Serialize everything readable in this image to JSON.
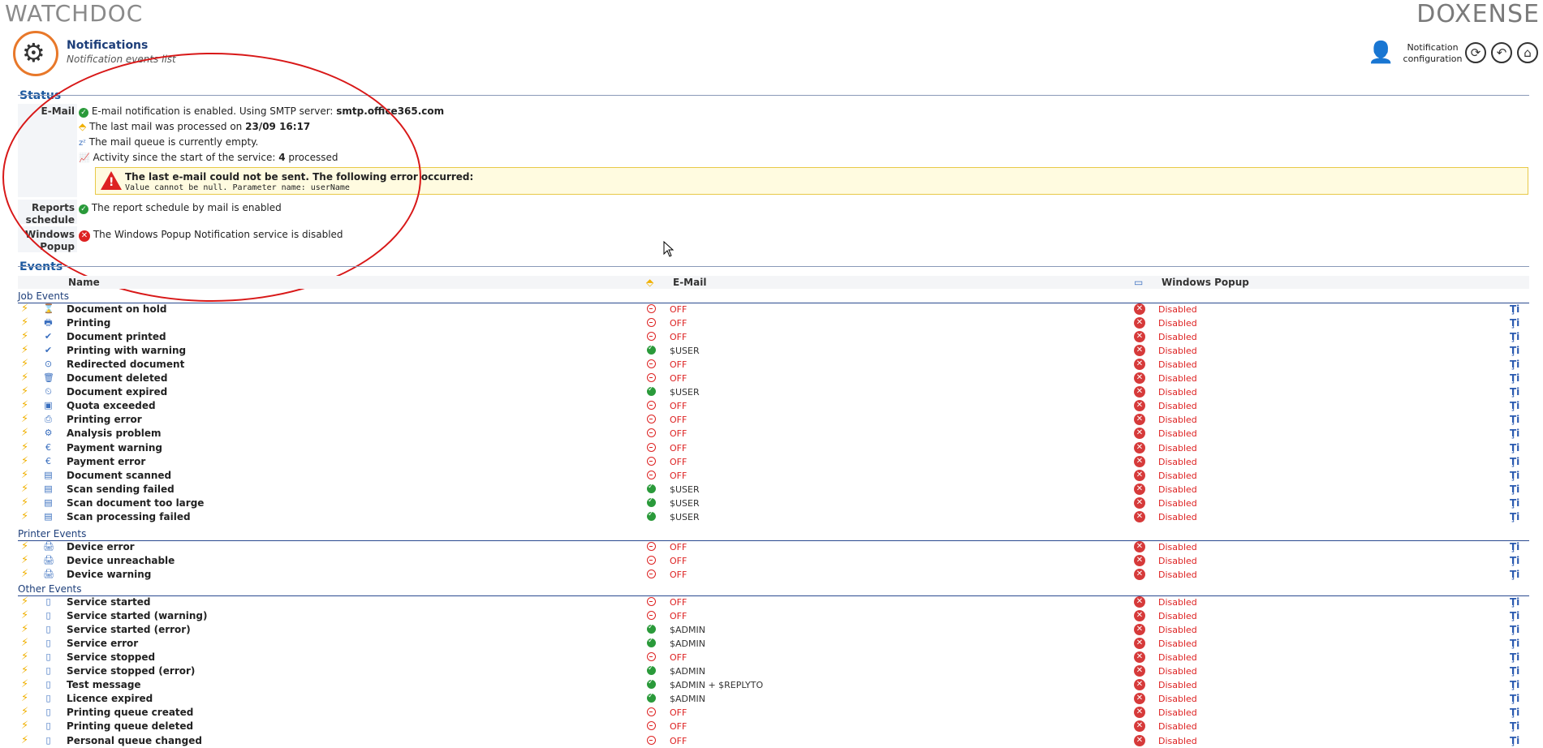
{
  "brand": {
    "left_logo": "WATCHDOC",
    "right_logo": "DOXENSE"
  },
  "header": {
    "title": "Notifications",
    "subtitle": "Notification events list",
    "config_label_line1": "Notification",
    "config_label_line2": "configuration"
  },
  "status": {
    "section_title": "Status",
    "email_label": "E-Mail",
    "email_enabled_prefix": "E-mail notification is enabled. Using SMTP server: ",
    "smtp_server": "smtp.office365.com",
    "last_mail_prefix": "The last mail was processed on ",
    "last_mail_time": "23/09 16:17",
    "queue_text": "The mail queue is currently empty.",
    "activity_prefix": "Activity since the start of the service: ",
    "activity_count": "4",
    "activity_suffix": " processed",
    "error_title": "The last e-mail could not be sent. The following error occurred:",
    "error_detail": "Value cannot be null. Parameter name: userName",
    "reports_label_1": "Reports",
    "reports_label_2": "schedule",
    "reports_text": "The report schedule by mail is enabled",
    "popup_label_1": "Windows",
    "popup_label_2": "Popup",
    "popup_text": "The Windows Popup Notification service is disabled"
  },
  "events": {
    "section_title": "Events",
    "col_name": "Name",
    "col_email": "E-Mail",
    "col_popup": "Windows Popup",
    "groups": [
      {
        "title": "Job Events",
        "rows": [
          {
            "name": "Document on hold",
            "email": "OFF",
            "email_on": false,
            "popup": "Disabled"
          },
          {
            "name": "Printing",
            "email": "OFF",
            "email_on": false,
            "popup": "Disabled"
          },
          {
            "name": "Document printed",
            "email": "OFF",
            "email_on": false,
            "popup": "Disabled"
          },
          {
            "name": "Printing with warning",
            "email": "$USER",
            "email_on": true,
            "popup": "Disabled"
          },
          {
            "name": "Redirected document",
            "email": "OFF",
            "email_on": false,
            "popup": "Disabled"
          },
          {
            "name": "Document deleted",
            "email": "OFF",
            "email_on": false,
            "popup": "Disabled"
          },
          {
            "name": "Document expired",
            "email": "$USER",
            "email_on": true,
            "popup": "Disabled"
          },
          {
            "name": "Quota exceeded",
            "email": "OFF",
            "email_on": false,
            "popup": "Disabled"
          },
          {
            "name": "Printing error",
            "email": "OFF",
            "email_on": false,
            "popup": "Disabled"
          },
          {
            "name": "Analysis problem",
            "email": "OFF",
            "email_on": false,
            "popup": "Disabled"
          },
          {
            "name": "Payment warning",
            "email": "OFF",
            "email_on": false,
            "popup": "Disabled"
          },
          {
            "name": "Payment error",
            "email": "OFF",
            "email_on": false,
            "popup": "Disabled"
          },
          {
            "name": "Document scanned",
            "email": "OFF",
            "email_on": false,
            "popup": "Disabled"
          },
          {
            "name": "Scan sending failed",
            "email": "$USER",
            "email_on": true,
            "popup": "Disabled"
          },
          {
            "name": "Scan document too large",
            "email": "$USER",
            "email_on": true,
            "popup": "Disabled"
          },
          {
            "name": "Scan processing failed",
            "email": "$USER",
            "email_on": true,
            "popup": "Disabled"
          }
        ]
      },
      {
        "title": "Printer Events",
        "rows": [
          {
            "name": "Device error",
            "email": "OFF",
            "email_on": false,
            "popup": "Disabled"
          },
          {
            "name": "Device unreachable",
            "email": "OFF",
            "email_on": false,
            "popup": "Disabled"
          },
          {
            "name": "Device warning",
            "email": "OFF",
            "email_on": false,
            "popup": "Disabled"
          }
        ]
      },
      {
        "title": "Other Events",
        "rows": [
          {
            "name": "Service started",
            "email": "OFF",
            "email_on": false,
            "popup": "Disabled"
          },
          {
            "name": "Service started (warning)",
            "email": "OFF",
            "email_on": false,
            "popup": "Disabled"
          },
          {
            "name": "Service started (error)",
            "email": "$ADMIN",
            "email_on": true,
            "popup": "Disabled"
          },
          {
            "name": "Service error",
            "email": "$ADMIN",
            "email_on": true,
            "popup": "Disabled"
          },
          {
            "name": "Service stopped",
            "email": "OFF",
            "email_on": false,
            "popup": "Disabled"
          },
          {
            "name": "Service stopped (error)",
            "email": "$ADMIN",
            "email_on": true,
            "popup": "Disabled"
          },
          {
            "name": "Test message",
            "email": "$ADMIN + $REPLYTO",
            "email_on": true,
            "popup": "Disabled"
          },
          {
            "name": "Licence expired",
            "email": "$ADMIN",
            "email_on": true,
            "popup": "Disabled"
          },
          {
            "name": "Printing queue created",
            "email": "OFF",
            "email_on": false,
            "popup": "Disabled"
          },
          {
            "name": "Printing queue deleted",
            "email": "OFF",
            "email_on": false,
            "popup": "Disabled"
          },
          {
            "name": "Personal queue changed",
            "email": "OFF",
            "email_on": false,
            "popup": "Disabled"
          }
        ]
      }
    ]
  },
  "colors": {
    "accent": "#e8782a",
    "title_blue": "#1e5aa0",
    "error_red": "#dd2222",
    "ok_green": "#2a9a3a"
  }
}
